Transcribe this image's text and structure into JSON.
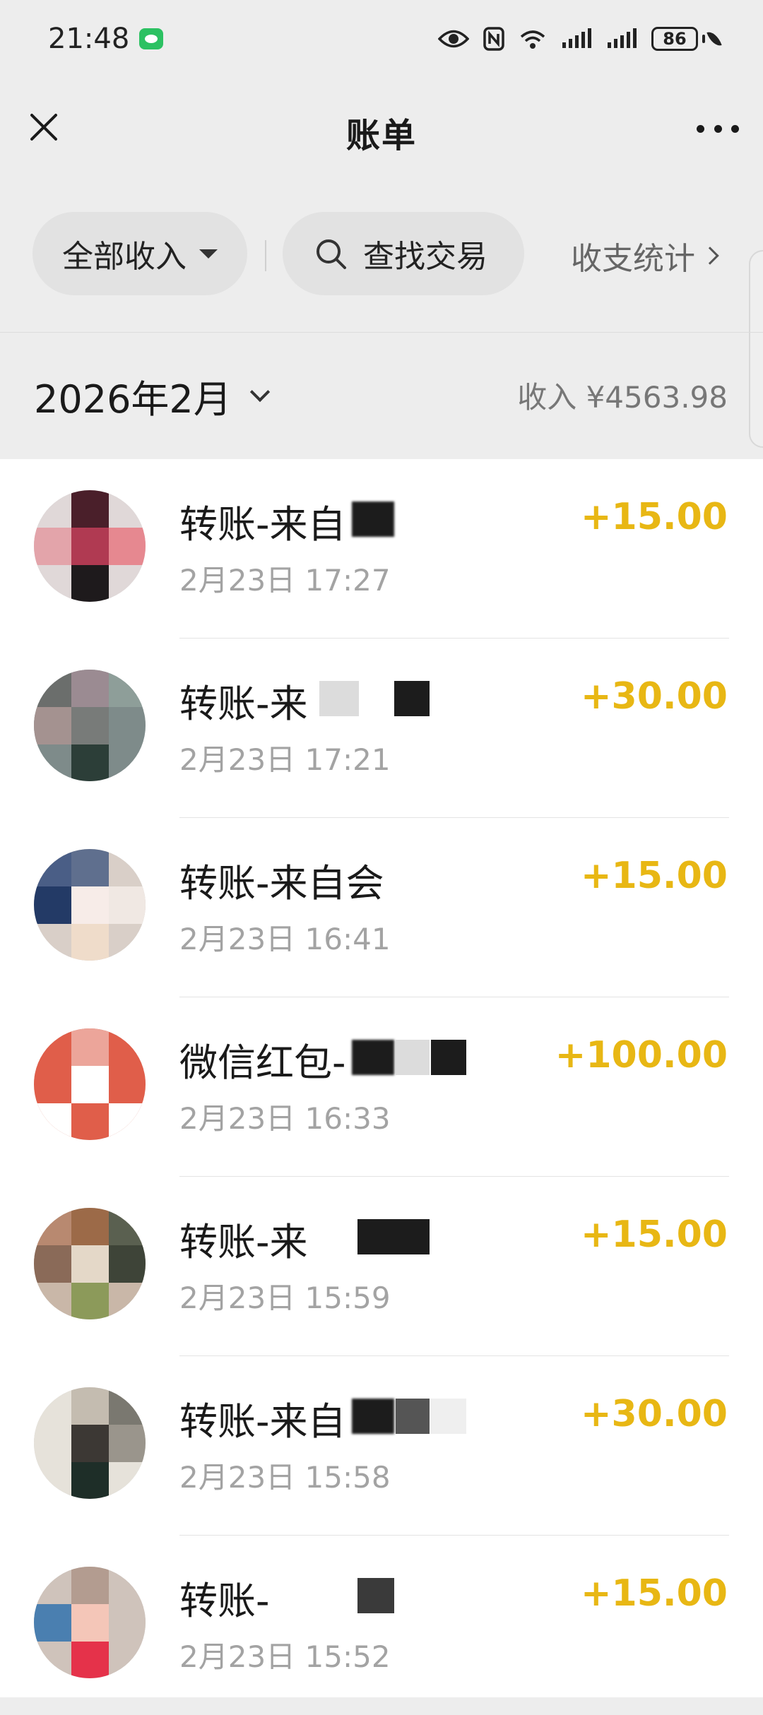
{
  "status_bar": {
    "time": "21:48",
    "icons": [
      "wechat-icon",
      "eye-icon",
      "nfc-icon",
      "wifi-6-icon",
      "signal-icon",
      "signal-icon"
    ],
    "battery": "86"
  },
  "nav": {
    "title": "账单"
  },
  "filters": {
    "all_income": "全部收入",
    "search": "查找交易",
    "stats": "收支统计"
  },
  "month": {
    "label": "2026年2月",
    "income_summary": "收入 ¥4563.98"
  },
  "colors": {
    "background": "#ededed",
    "amount": "#e8b714",
    "list_bg": "#ffffff",
    "date_text": "#a3a3a3"
  },
  "transactions": [
    {
      "title": "转账-来自",
      "date": "2月23日 17:27",
      "amount": "+15.00"
    },
    {
      "title": "转账-来",
      "date": "2月23日 17:21",
      "amount": "+30.00"
    },
    {
      "title": "转账-来自会",
      "date": "2月23日 16:41",
      "amount": "+15.00"
    },
    {
      "title": "微信红包-",
      "date": "2月23日 16:33",
      "amount": "+100.00"
    },
    {
      "title": "转账-来",
      "date": "2月23日 15:59",
      "amount": "+15.00"
    },
    {
      "title": "转账-来自",
      "date": "2月23日 15:58",
      "amount": "+30.00"
    },
    {
      "title": "转账-",
      "date": "2月23日 15:52",
      "amount": "+15.00"
    }
  ]
}
